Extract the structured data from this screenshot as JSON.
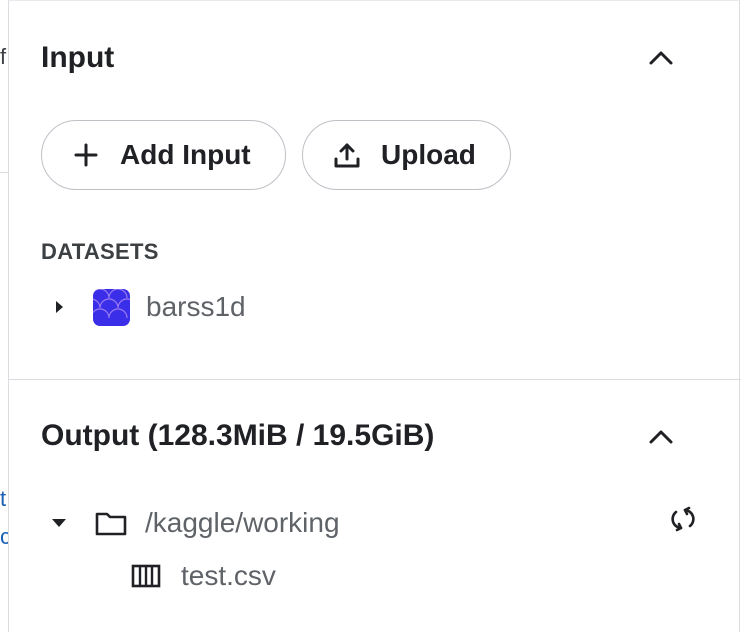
{
  "background": {
    "partial_char": "f",
    "partial_links": [
      "t",
      "c"
    ]
  },
  "input_section": {
    "title": "Input",
    "buttons": {
      "add_input_label": "Add Input",
      "upload_label": "Upload"
    },
    "datasets_label": "DATASETS",
    "datasets": [
      {
        "name": "barss1d",
        "expanded": false
      }
    ]
  },
  "output_section": {
    "title": "Output (128.3MiB / 19.5GiB)",
    "folder": {
      "path": "/kaggle/working",
      "expanded": true
    },
    "files": [
      {
        "name": "test.csv"
      }
    ]
  },
  "colors": {
    "dataset_thumb": "#3b2ee8",
    "divider": "#dadce0",
    "text_primary": "#202124",
    "text_secondary": "#5f6368"
  }
}
